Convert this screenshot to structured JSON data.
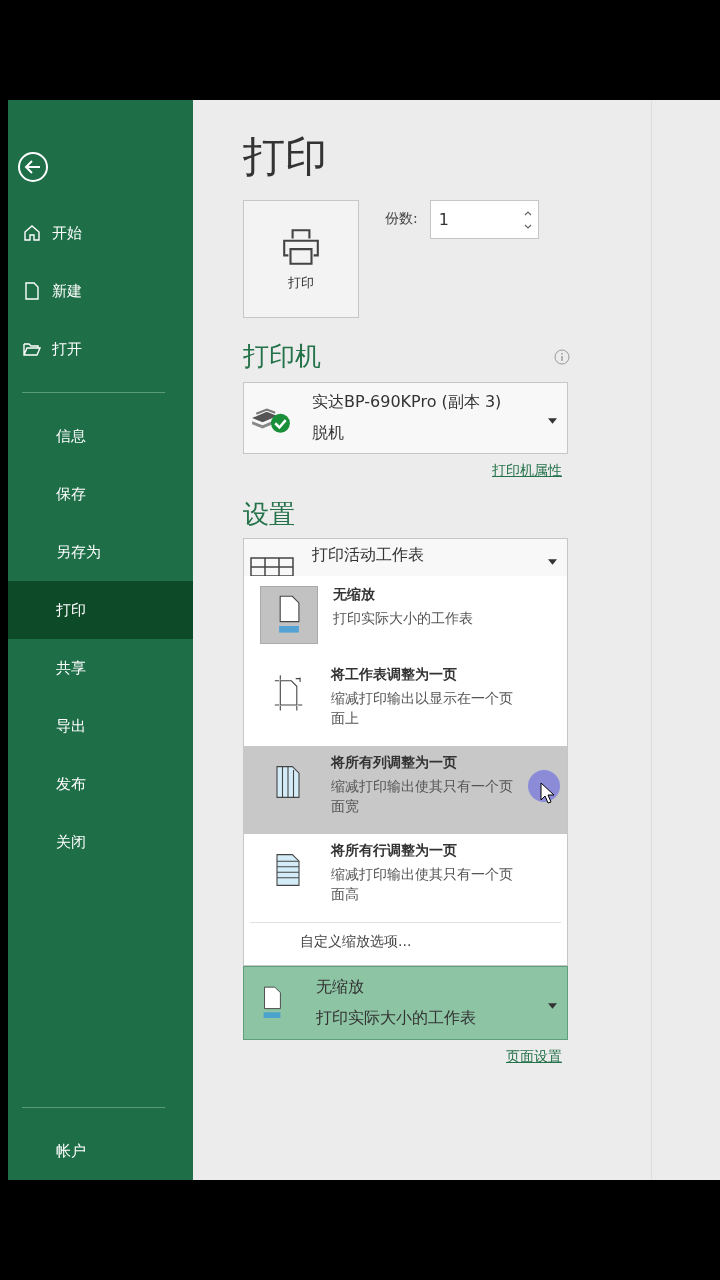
{
  "sidebar": {
    "top_items": [
      {
        "label": "开始",
        "kind": "home",
        "selected": false
      },
      {
        "label": "新建",
        "kind": "new",
        "selected": false
      },
      {
        "label": "打开",
        "kind": "open",
        "selected": false
      }
    ],
    "items": [
      {
        "label": "信息",
        "selected": false
      },
      {
        "label": "保存",
        "selected": false
      },
      {
        "label": "另存为",
        "selected": false
      },
      {
        "label": "打印",
        "selected": true
      },
      {
        "label": "共享",
        "selected": false
      },
      {
        "label": "导出",
        "selected": false
      },
      {
        "label": "发布",
        "selected": false
      },
      {
        "label": "关闭",
        "selected": false
      }
    ],
    "bottom_items": [
      {
        "label": "帐户",
        "selected": false
      }
    ]
  },
  "title": "打印",
  "print_button": {
    "label": "打印"
  },
  "copies": {
    "label": "份数:",
    "value": "1"
  },
  "printer": {
    "heading": "打印机",
    "name": "实达BP-690KPro (副本 3)",
    "status": "脱机",
    "properties_link": "打印机属性"
  },
  "settings": {
    "heading": "设置",
    "scope": {
      "label": "打印活动工作表"
    },
    "scaling_menu": [
      {
        "kind": "none",
        "title": "无缩放",
        "description": "打印实际大小的工作表",
        "selected": true,
        "hovered": false
      },
      {
        "kind": "sheet",
        "title": "将工作表调整为一页",
        "description": "缩减打印输出以显示在一个页面上",
        "selected": false,
        "hovered": false
      },
      {
        "kind": "columns",
        "title": "将所有列调整为一页",
        "description": "缩减打印输出使其只有一个页面宽",
        "selected": false,
        "hovered": true
      },
      {
        "kind": "rows",
        "title": "将所有行调整为一页",
        "description": "缩减打印输出使其只有一个页面高",
        "selected": false,
        "hovered": false
      }
    ],
    "custom_option": "自定义缩放选项...",
    "scaling": {
      "title": "无缩放",
      "description": "打印实际大小的工作表"
    },
    "page_setup_link": "页面设置"
  }
}
